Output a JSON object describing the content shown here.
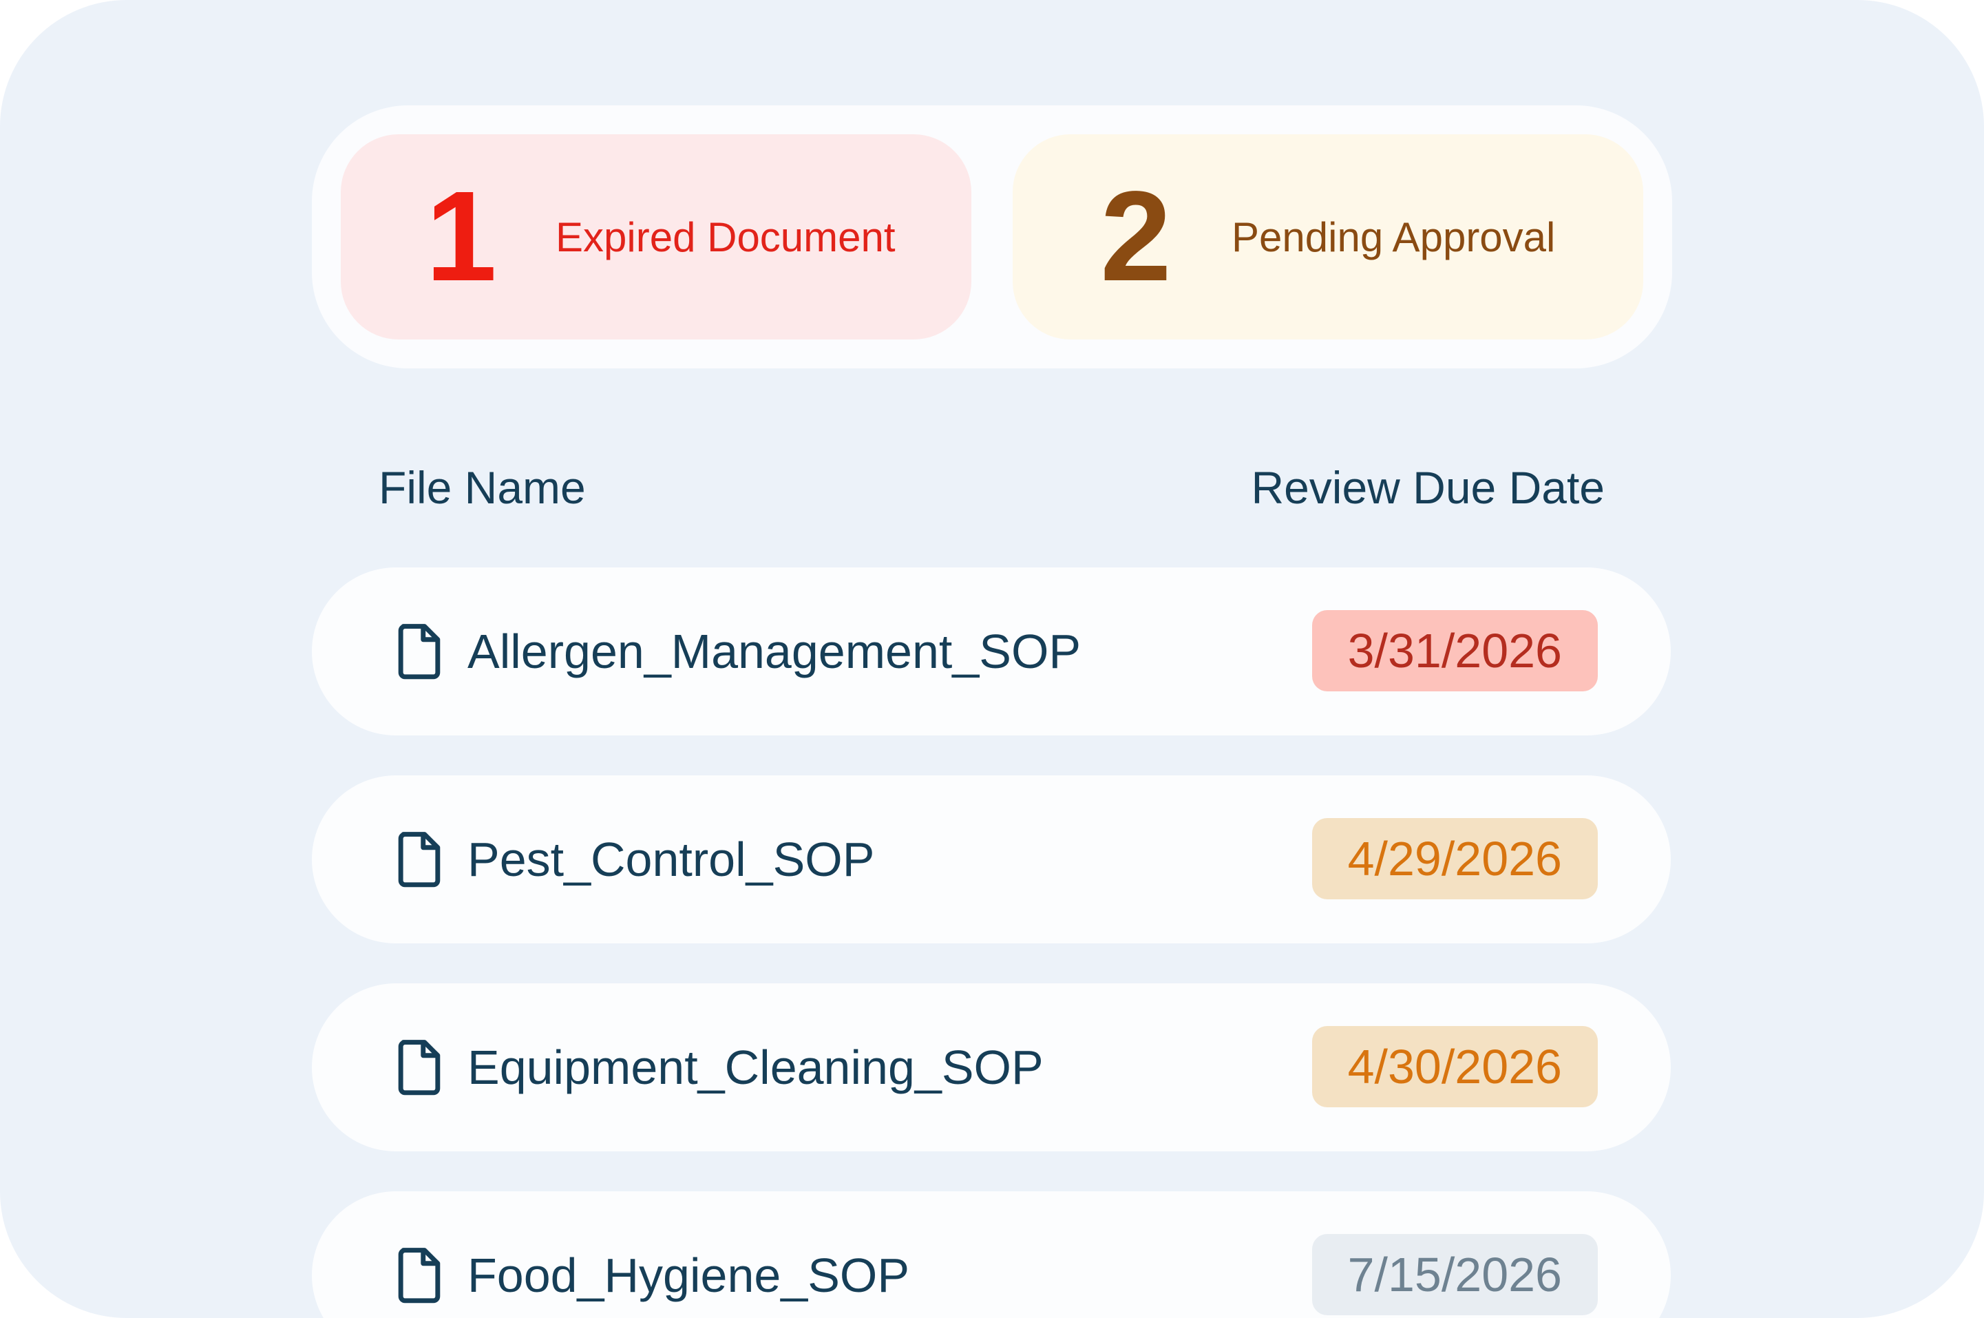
{
  "summary": {
    "expired": {
      "count": "1",
      "label": "Expired Document"
    },
    "pending": {
      "count": "2",
      "label": "Pending Approval"
    }
  },
  "table": {
    "headers": {
      "file_name": "File Name",
      "due_date": "Review Due Date"
    },
    "rows": [
      {
        "name": "Allergen_Management_SOP",
        "date": "3/31/2026",
        "status": "expired"
      },
      {
        "name": "Pest_Control_SOP",
        "date": "4/29/2026",
        "status": "due-soon"
      },
      {
        "name": "Equipment_Cleaning_SOP",
        "date": "4/30/2026",
        "status": "due-soon"
      },
      {
        "name": "Food_Hygiene_SOP",
        "date": "7/15/2026",
        "status": "normal"
      }
    ]
  },
  "icons": {
    "file": "file-icon"
  },
  "colors": {
    "expired": "#e2231a",
    "pending": "#8a4b12",
    "due_soon": "#d8740f",
    "normal": "#6e8291",
    "text": "#163e57",
    "background": "#ecf2f9"
  }
}
